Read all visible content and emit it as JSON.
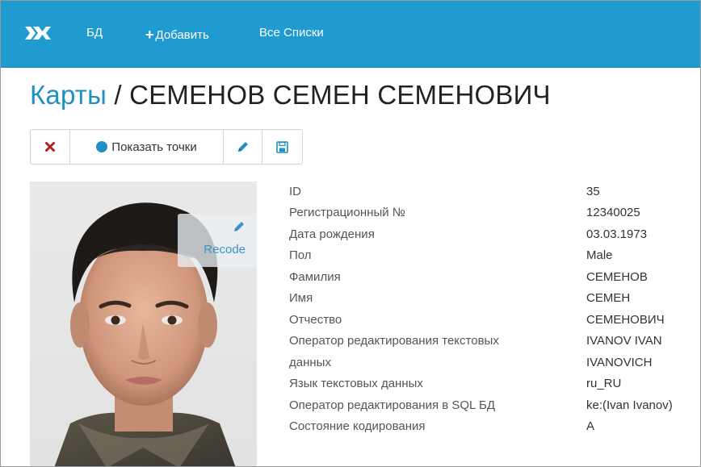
{
  "navbar": {
    "logo": "logo-icon",
    "links": [
      {
        "label": "БД"
      },
      {
        "label": "Добавить",
        "icon": "plus-icon"
      },
      {
        "label": "Все Списки"
      }
    ]
  },
  "title": {
    "breadcrumb": "Карты",
    "separator": " / ",
    "name": "СЕМЕНОВ СЕМЕН СЕМЕНОВИЧ"
  },
  "toolbar": {
    "close_icon": "close-icon",
    "show_points_label": "Показать точки",
    "edit_icon": "pencil-icon",
    "save_icon": "save-icon"
  },
  "photo": {
    "recode_label": "Recode",
    "recode_icon": "pencil-icon"
  },
  "details": [
    {
      "label": "ID",
      "value": "35"
    },
    {
      "label": "Регистрационный №",
      "value": "12340025"
    },
    {
      "label": "Дата рождения",
      "value": "03.03.1973"
    },
    {
      "label": "Пол",
      "value": "Male"
    },
    {
      "label": "Фамилия",
      "value": "СЕМЕНОВ"
    },
    {
      "label": "Имя",
      "value": "СЕМЕН"
    },
    {
      "label": "Отчество",
      "value": "СЕМЕНОВИЧ"
    },
    {
      "label": "Оператор редактирования текстовых",
      "value": "IVANOV IVAN"
    },
    {
      "label": "данных",
      "value": "IVANOVICH"
    },
    {
      "label": "Язык текстовых данных",
      "value": "ru_RU"
    },
    {
      "label": "Оператор редактирования в SQL БД",
      "value": "ke:(Ivan Ivanov)"
    },
    {
      "label": "Состояние кодирования",
      "value": "A"
    }
  ],
  "colors": {
    "navbar": "#1f9bd1",
    "accent": "#1f8fc4",
    "close": "#b22222"
  }
}
